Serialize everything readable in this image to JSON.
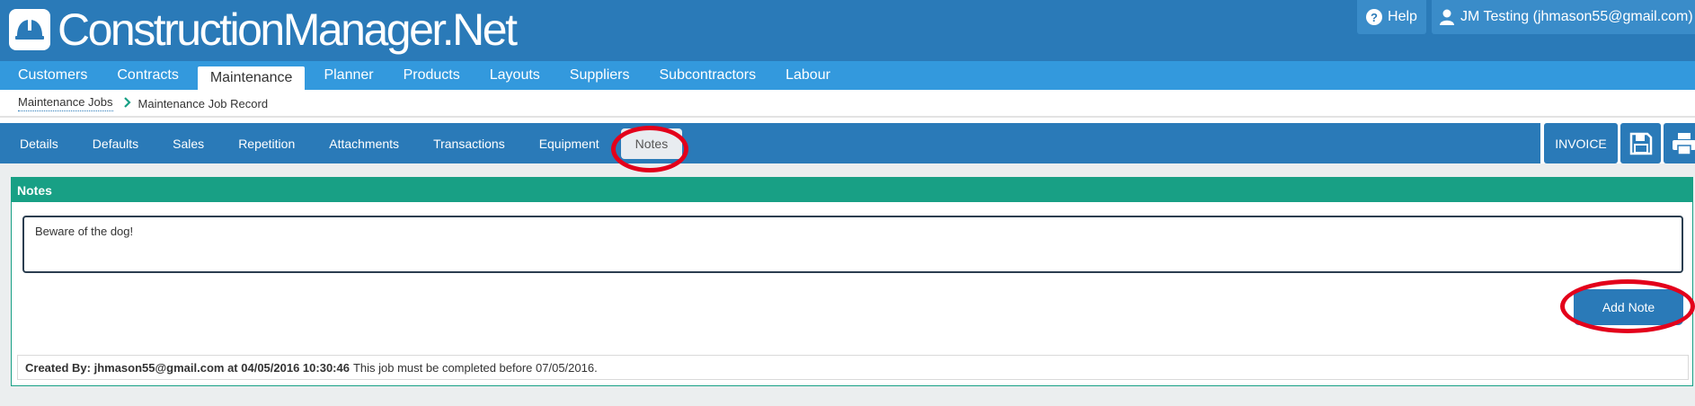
{
  "header": {
    "app_title": "ConstructionManager.Net",
    "help_label": "Help",
    "user_label": "JM Testing (jhmason55@gmail.com)"
  },
  "main_nav": {
    "items": [
      {
        "label": "Customers"
      },
      {
        "label": "Contracts"
      },
      {
        "label": "Maintenance",
        "active": true
      },
      {
        "label": "Planner"
      },
      {
        "label": "Products"
      },
      {
        "label": "Layouts"
      },
      {
        "label": "Suppliers"
      },
      {
        "label": "Subcontractors"
      },
      {
        "label": "Labour"
      }
    ]
  },
  "breadcrumb": {
    "parent": "Maintenance Jobs",
    "current": "Maintenance Job Record"
  },
  "sub_nav": {
    "tabs": [
      {
        "label": "Details"
      },
      {
        "label": "Defaults"
      },
      {
        "label": "Sales"
      },
      {
        "label": "Repetition"
      },
      {
        "label": "Attachments"
      },
      {
        "label": "Transactions"
      },
      {
        "label": "Equipment"
      },
      {
        "label": "Notes",
        "active": true
      }
    ],
    "invoice_label": "INVOICE"
  },
  "notes_panel": {
    "title": "Notes",
    "input_value": "Beware of the dog!",
    "add_button_label": "Add Note",
    "existing_note": {
      "prefix": "Created By: jhmason55@gmail.com at 04/05/2016 10:30:46",
      "text": "This job must be completed before 07/05/2016."
    }
  },
  "colors": {
    "header_bg": "#2a7ab8",
    "main_nav_bg": "#3399dd",
    "panel_accent": "#18a085",
    "annotation": "#e3001b"
  },
  "icons": [
    "hard-hat-icon",
    "help-icon",
    "user-icon",
    "chevron-right-icon",
    "save-icon",
    "print-icon"
  ]
}
